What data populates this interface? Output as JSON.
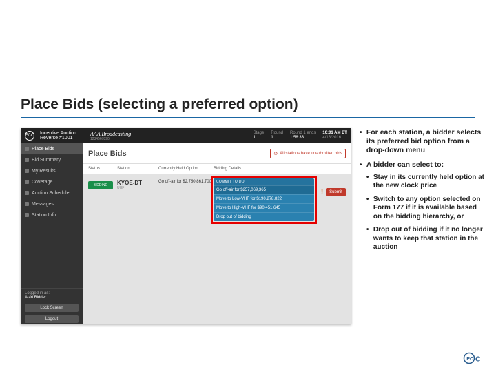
{
  "slide": {
    "title": "Place Bids (selecting a preferred option)"
  },
  "topbar": {
    "logo_text": "FCC",
    "product": "Incentive Auction",
    "subproduct": "Reverse #1001",
    "broadcaster": "AAA Broadcasting",
    "broadcaster_id": "1234567890",
    "stage_label": "Stage",
    "stage_val": "1",
    "round_label": "Round",
    "round_val": "1",
    "ends_label": "Round 1 ends",
    "ends_val": "1:58:33",
    "time": "10:01 AM ET",
    "date": "4/18/2016"
  },
  "sidebar": {
    "items": [
      {
        "label": "Place Bids"
      },
      {
        "label": "Bid Summary"
      },
      {
        "label": "My Results"
      },
      {
        "label": "Coverage"
      },
      {
        "label": "Auction Schedule"
      },
      {
        "label": "Messages"
      },
      {
        "label": "Station Info"
      }
    ],
    "logged_in_label": "Logged in as:",
    "user": "Alan Bidder",
    "lock": "Lock Screen",
    "logout": "Logout"
  },
  "main": {
    "title": "Place Bids",
    "warning": "All stations have unsubmitted bids",
    "cols": {
      "status": "Status",
      "station": "Station",
      "opt": "Currently Held Option",
      "det": "Bidding Details"
    },
    "row": {
      "badge": "BIDDING",
      "call": "KYOE-DT",
      "sub_market": "UHF",
      "cur_opt": "Go off-air for $2,750,861,700",
      "submit": "Submit"
    },
    "dropdown": {
      "header": "COMMIT TO DO",
      "items": [
        "Go off-air for $257,069,365",
        "Move to Low-VHF for $190,278,822",
        "Move to High-VHF for $90,451,645",
        "Drop out of bidding"
      ]
    }
  },
  "notes": {
    "b1": "For each station, a bidder selects its preferred bid option from a drop-down menu",
    "b2": "A bidder can select to:",
    "s1": "Stay in its currently held option at the new clock price",
    "s2": "Switch to any option selected on Form 177 if it is available based on the bidding hierarchy, or",
    "s3": "Drop out of bidding if it no longer wants to keep that station in the auction"
  }
}
